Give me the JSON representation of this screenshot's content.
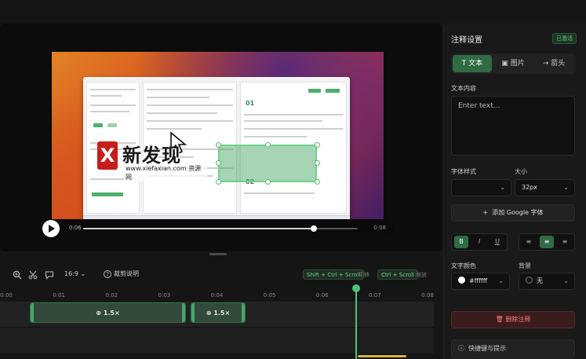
{
  "player": {
    "current_time": "0:06",
    "end_time": "0:08",
    "progress": 0.84
  },
  "watermark": {
    "mark": "X",
    "text": "新发现",
    "sub": "www.xiefaxian.com 资源网"
  },
  "video_screenshot": {
    "step_number_1": "01",
    "step_number_2": "02"
  },
  "toolbar": {
    "aspect_ratio": "16:9",
    "help_label": "裁剪说明",
    "shortcut_pan_keys": "Shift + Ctrl + Scroll",
    "shortcut_pan_label": "平移",
    "shortcut_zoom_keys": "Ctrl + Scroll",
    "shortcut_zoom_label": "缩放"
  },
  "timeline": {
    "ticks": [
      "0:00",
      "0:01",
      "0:02",
      "0:03",
      "0:04",
      "0:05",
      "0:06",
      "0:07",
      "0:08"
    ],
    "clips": [
      {
        "label": "1.5×"
      },
      {
        "label": "1.5×"
      }
    ]
  },
  "panel": {
    "title": "注释设置",
    "status": "已激活",
    "tabs": [
      {
        "label": "文本",
        "icon": "text-icon",
        "active": true
      },
      {
        "label": "图片",
        "icon": "image-icon",
        "active": false
      },
      {
        "label": "箭头",
        "icon": "arrow-icon",
        "active": false
      }
    ],
    "text_content_label": "文本内容",
    "text_placeholder": "Enter text...",
    "font_style_label": "字体样式",
    "font_style_value": "",
    "size_label": "大小",
    "size_value": "32px",
    "add_font_label": "添加 Google 字体",
    "style_buttons": [
      "B",
      "I",
      "U"
    ],
    "align_buttons": [
      "≡",
      "≡",
      "≡"
    ],
    "text_color_label": "文字颜色",
    "text_color_value": "#ffffff",
    "background_label": "背景",
    "background_value": "无",
    "delete_label": "删除注释",
    "shortcuts_label": "快捷键与提示"
  },
  "colors": {
    "accent": "#2f6b45",
    "accent_text": "#4bc47a",
    "danger": "#ff7b7b"
  }
}
